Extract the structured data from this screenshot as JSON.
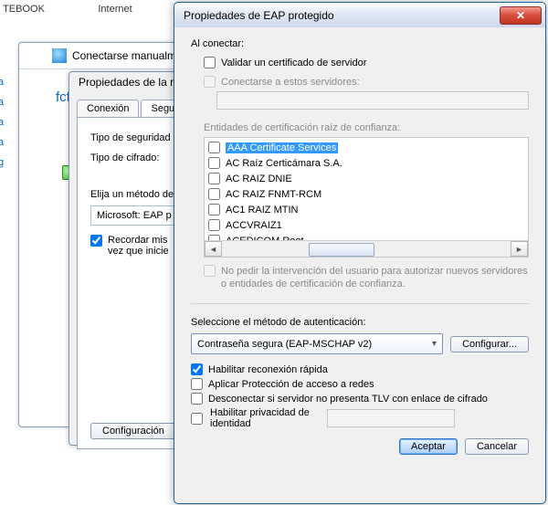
{
  "desktop": {
    "icon1": "TEBOOK",
    "icon2": "Internet"
  },
  "wizard": {
    "title": "Conectarse manualmente",
    "network": "fcfm :"
  },
  "props": {
    "title": "Propiedades de la re",
    "tab_connection": "Conexión",
    "tab_security": "Seguric",
    "security_type_label": "Tipo de seguridad",
    "cipher_type_label": "Tipo de cifrado:",
    "choose_method": "Elija un método de",
    "method_value": "Microsoft: EAP p",
    "remember": "Recordar mis\nvez que inicie",
    "config_btn": "Configuración"
  },
  "eap": {
    "title": "Propiedades de EAP protegido",
    "on_connect": "Al conectar:",
    "validate_cert": "Validar un certificado de servidor",
    "connect_servers": "Conectarse a estos servidores:",
    "ca_label": "Entidades de certificación raíz de confianza:",
    "ca_items": [
      "AAA Certificate Services",
      "AC Raíz Certicámara S.A.",
      "AC RAIZ DNIE",
      "AC RAIZ FNMT-RCM",
      "AC1 RAIZ MTIN",
      "ACCVRAIZ1",
      "ACEDICOM Root"
    ],
    "no_prompt": "No pedir la intervención del usuario para autorizar nuevos servidores o entidades de certificación de confianza.",
    "auth_label": "Seleccione el método de autenticación:",
    "auth_value": "Contraseña segura (EAP-MSCHAP v2)",
    "config_btn": "Configurar...",
    "fast_reconnect": "Habilitar reconexión rápida",
    "nap": "Aplicar Protección de acceso a redes",
    "tlv": "Desconectar si servidor no presenta TLV con enlace de cifrado",
    "identity_priv": "Habilitar privacidad de identidad",
    "ok": "Aceptar",
    "cancel": "Cancelar"
  }
}
